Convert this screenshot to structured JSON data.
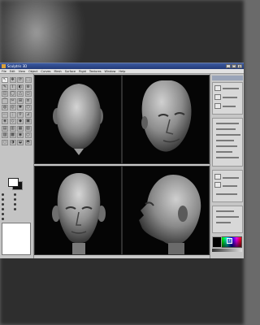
{
  "window": {
    "title": "Sculptris 3D",
    "controls": [
      "_",
      "□",
      "x"
    ]
  },
  "menubar": [
    "File",
    "Edit",
    "View",
    "Object",
    "Curves",
    "Mesh",
    "Surface",
    "Rigid",
    "Textures",
    "Window",
    "Help"
  ],
  "toolbox": {
    "tools": [
      "↖",
      "✥",
      "⟳",
      "⬚",
      "✎",
      "⌇",
      "◐",
      "⊕",
      "◫",
      "◯",
      "△",
      "◻",
      "⌒",
      "✂",
      "⊞",
      "≡",
      "◍",
      "◎",
      "✱",
      "⬡",
      "⋯",
      "⋮",
      "⚲",
      "⊿",
      "◈",
      "◇",
      "◆",
      "▣",
      "▤",
      "▥",
      "▦",
      "▧",
      "▨",
      "▩",
      "◉",
      "○",
      "◌",
      "◑",
      "◒",
      "◓"
    ],
    "options": [
      "",
      "",
      "",
      "",
      "",
      ""
    ],
    "list": [
      "",
      "",
      "",
      "",
      "",
      ""
    ]
  },
  "viewports": [
    {
      "view": "top"
    },
    {
      "view": "perspective"
    },
    {
      "view": "front"
    },
    {
      "view": "side"
    }
  ],
  "right_panel": {
    "header": ""
  },
  "colors": {
    "titlebar": "#223a78",
    "viewport_bg": "#050505",
    "head_light": "#c9c9c9",
    "head_dark": "#3b3b3b"
  },
  "icons": {
    "help": "help-icon"
  }
}
